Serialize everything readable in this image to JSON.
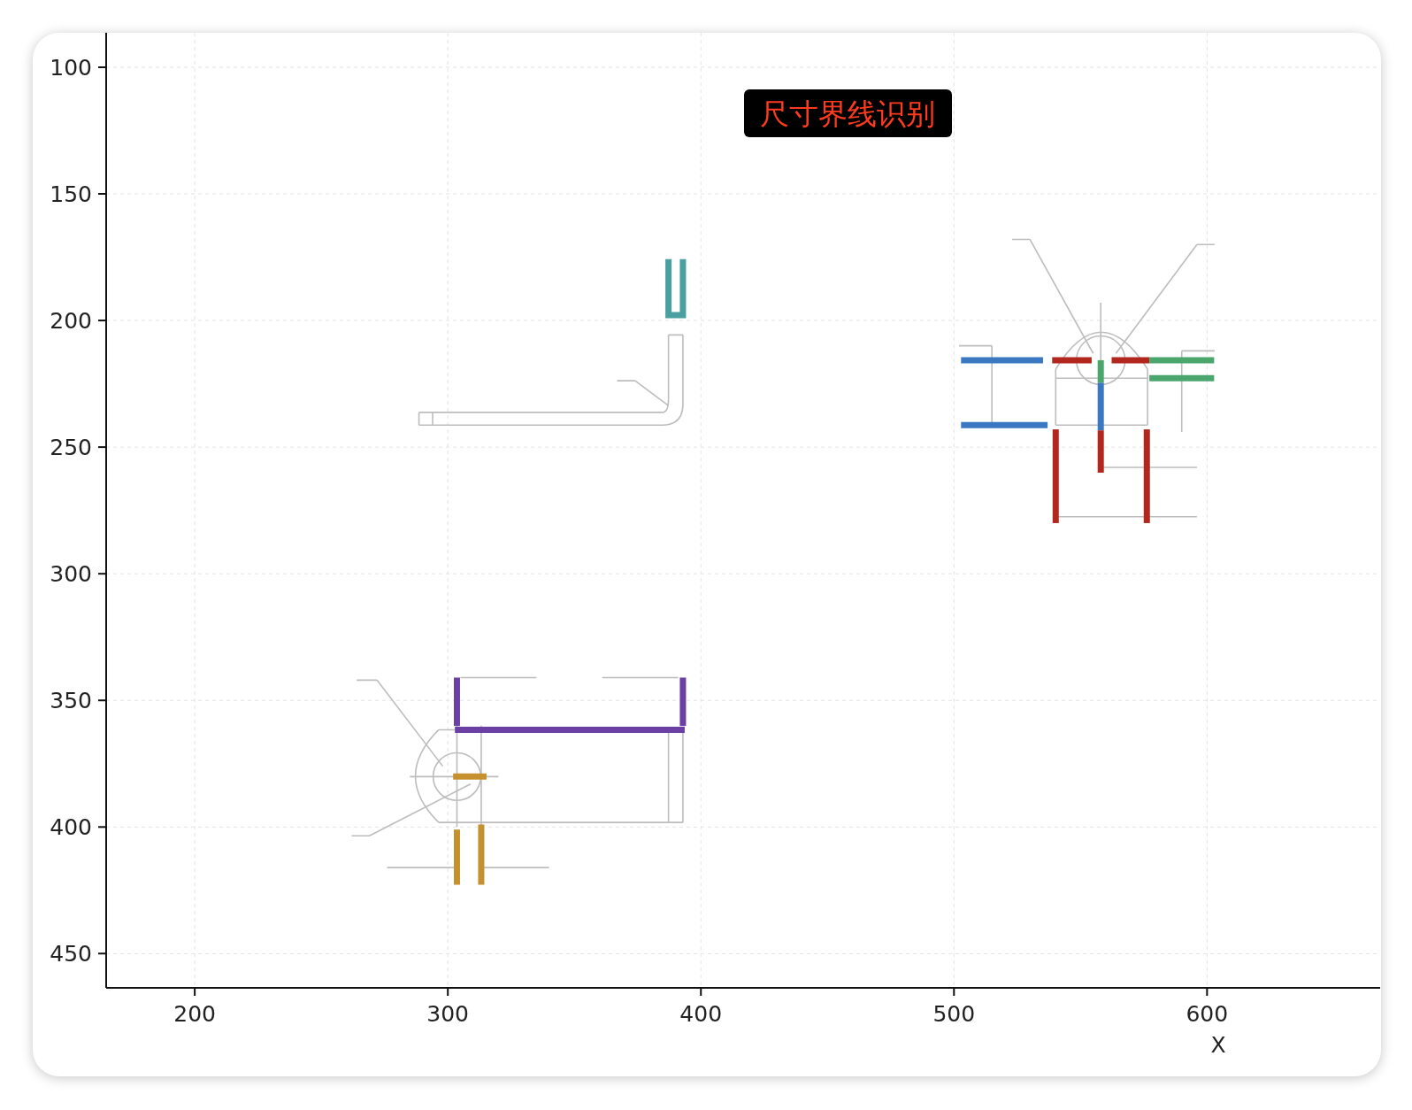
{
  "chart_data": {
    "type": "line",
    "title": "尺寸界线识别",
    "xlabel": "X",
    "grid": true,
    "xlim": [
      165,
      668.4
    ],
    "ylim": [
      463.5,
      86.4
    ],
    "xticks": [
      200,
      300,
      400,
      500,
      600
    ],
    "yticks": [
      100,
      150,
      200,
      250,
      300,
      350,
      400,
      450
    ],
    "series": [
      {
        "color": "#4a9fa0",
        "x": [
          387.2,
          387.2,
          392.9,
          392.9
        ],
        "values": [
          175.8,
          197.9,
          197.9,
          175.8
        ]
      },
      {
        "color": "#3b78c2",
        "x": [
          502.8,
          535.2
        ],
        "values": [
          215.7,
          215.7
        ]
      },
      {
        "color": "#3b78c2",
        "x": [
          502.8,
          537
        ],
        "values": [
          241.3,
          241.3
        ]
      },
      {
        "color": "#b3261e",
        "x": [
          538.8,
          554.4
        ],
        "values": [
          215.7,
          215.7
        ]
      },
      {
        "color": "#b3261e",
        "x": [
          562.3,
          577.2
        ],
        "values": [
          215.7,
          215.7
        ]
      },
      {
        "color": "#4aa66c",
        "x": [
          558,
          558
        ],
        "values": [
          215.7,
          224.6
        ]
      },
      {
        "color": "#3b78c2",
        "x": [
          558,
          558
        ],
        "values": [
          224.6,
          243.4
        ]
      },
      {
        "color": "#4aa66c",
        "x": [
          577.2,
          602.8
        ],
        "values": [
          215.7,
          215.7
        ]
      },
      {
        "color": "#4aa66c",
        "x": [
          577.2,
          602.8
        ],
        "values": [
          222.8,
          222.8
        ]
      },
      {
        "color": "#b3261e",
        "x": [
          558,
          558
        ],
        "values": [
          243.4,
          260.1
        ]
      },
      {
        "color": "#b3261e",
        "x": [
          540.2,
          540.2
        ],
        "values": [
          243,
          280
        ]
      },
      {
        "color": "#b3261e",
        "x": [
          576.2,
          576.2
        ],
        "values": [
          243,
          280
        ]
      },
      {
        "color": "#6b3fa3",
        "x": [
          303.6,
          303.6
        ],
        "values": [
          341,
          360.1
        ]
      },
      {
        "color": "#6b3fa3",
        "x": [
          392.9,
          392.9
        ],
        "values": [
          341,
          360.1
        ]
      },
      {
        "color": "#6b3fa3",
        "x": [
          302.8,
          393.6
        ],
        "values": [
          361.6,
          361.6
        ]
      },
      {
        "color": "#c7902f",
        "x": [
          302.1,
          315.3
        ],
        "values": [
          380.1,
          380.1
        ]
      },
      {
        "color": "#c7902f",
        "x": [
          303.6,
          303.6
        ],
        "values": [
          401,
          422.8
        ]
      },
      {
        "color": "#c7902f",
        "x": [
          313.2,
          313.2
        ],
        "values": [
          399,
          422.8
        ]
      }
    ]
  }
}
